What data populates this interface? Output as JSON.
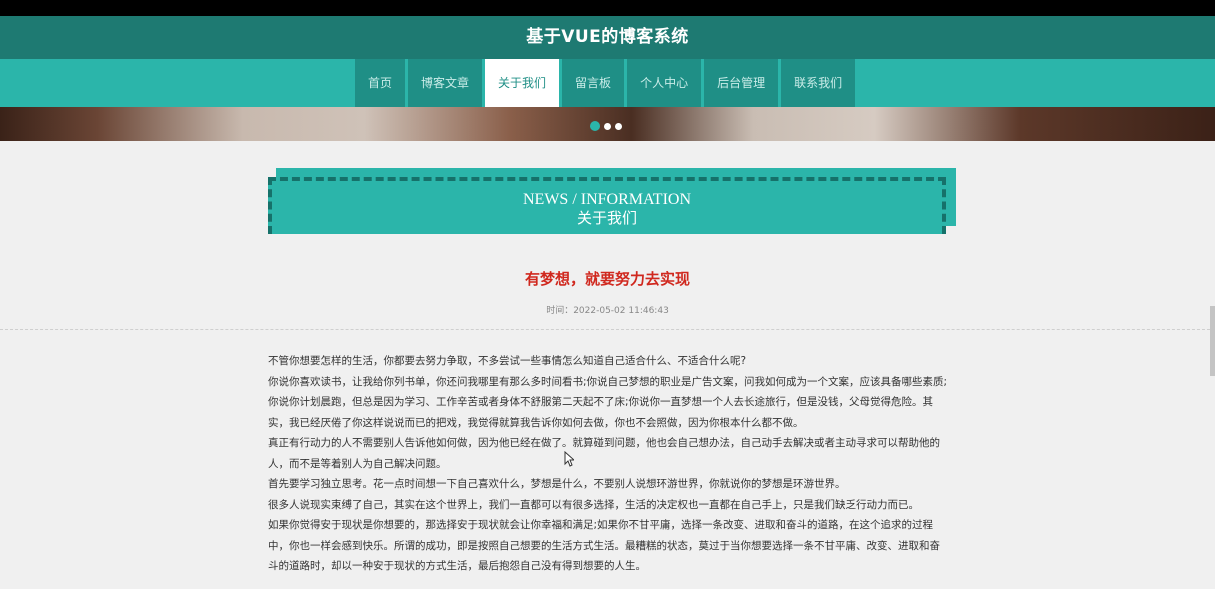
{
  "header": {
    "title": "基于VUE的博客系统"
  },
  "nav": {
    "items": [
      {
        "label": "首页",
        "active": false
      },
      {
        "label": "博客文章",
        "active": false
      },
      {
        "label": "关于我们",
        "active": true
      },
      {
        "label": "留言板",
        "active": false
      },
      {
        "label": "个人中心",
        "active": false
      },
      {
        "label": "后台管理",
        "active": false
      },
      {
        "label": "联系我们",
        "active": false
      }
    ]
  },
  "carousel": {
    "slide_count": 3,
    "active_index": 0
  },
  "section": {
    "heading_en": "NEWS / INFORMATION",
    "heading_zh": "关于我们"
  },
  "article": {
    "title": "有梦想，就要努力去实现",
    "time": "时间：2022-05-02 11:46:43",
    "paragraphs": [
      "不管你想要怎样的生活，你都要去努力争取，不多尝试一些事情怎么知道自己适合什么、不适合什么呢?",
      "你说你喜欢读书，让我给你列书单，你还问我哪里有那么多时间看书;你说自己梦想的职业是广告文案，问我如何成为一个文案，应该具备哪些素质;你说你计划晨跑，但总是因为学习、工作辛苦或者身体不舒服第二天起不了床;你说你一直梦想一个人去长途旅行，但是没钱，父母觉得危险。其实，我已经厌倦了你这样说说而已的把戏，我觉得就算我告诉你如何去做，你也不会照做，因为你根本什么都不做。",
      "真正有行动力的人不需要别人告诉他如何做，因为他已经在做了。就算碰到问题，他也会自己想办法，自己动手去解决或者主动寻求可以帮助他的人，而不是等着别人为自己解决问题。",
      "首先要学习独立思考。花一点时间想一下自己喜欢什么，梦想是什么，不要别人说想环游世界，你就说你的梦想是环游世界。",
      "很多人说现实束缚了自己，其实在这个世界上，我们一直都可以有很多选择，生活的决定权也一直都在自己手上，只是我们缺乏行动力而已。",
      "如果你觉得安于现状是你想要的，那选择安于现状就会让你幸福和满足;如果你不甘平庸，选择一条改变、进取和奋斗的道路，在这个追求的过程中，你也一样会感到快乐。所谓的成功，即是按照自己想要的生活方式生活。最糟糕的状态，莫过于当你想要选择一条不甘平庸、改变、进取和奋斗的道路时，却以一种安于现状的方式生活，最后抱怨自己没有得到想要的人生。"
    ]
  }
}
